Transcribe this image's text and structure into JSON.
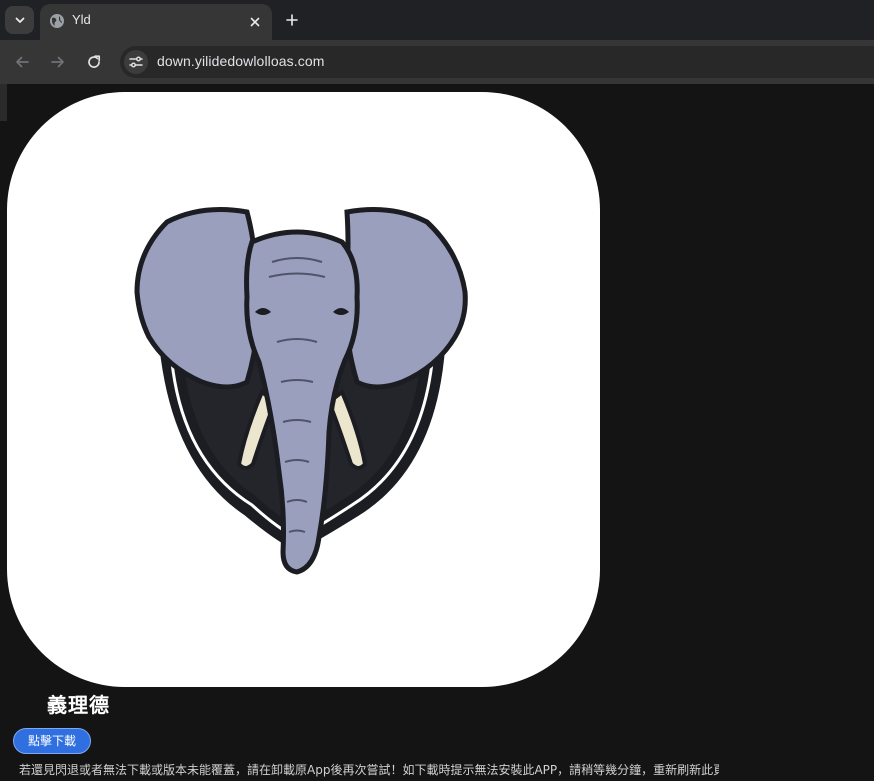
{
  "browser": {
    "tab": {
      "title": "Yld",
      "favicon": "globe-icon"
    },
    "url": "down.yilidedowlolloas.com",
    "icons": {
      "tab_list": "chevron-down-icon",
      "tab_close": "close-icon",
      "new_tab": "plus-icon",
      "back": "arrow-left-icon",
      "forward": "arrow-right-icon",
      "reload": "reload-icon",
      "site_info": "tune-icon"
    }
  },
  "page": {
    "app_name": "義理德",
    "download_label": "點擊下載",
    "notice": "若還見閃退或者無法下載或版本未能覆蓋，請在卸載原App後再次嘗試！如下載時提示無法安裝此APP，請稍等幾分鐘，重新刷新此頁",
    "icon_subject": "elephant-logo",
    "colors": {
      "page_bg": "#141414",
      "button": "#2f6fe0",
      "elephant_skin": "#9a9fbe",
      "shield": "#1c1d22",
      "tusk": "#ede6cf"
    }
  }
}
